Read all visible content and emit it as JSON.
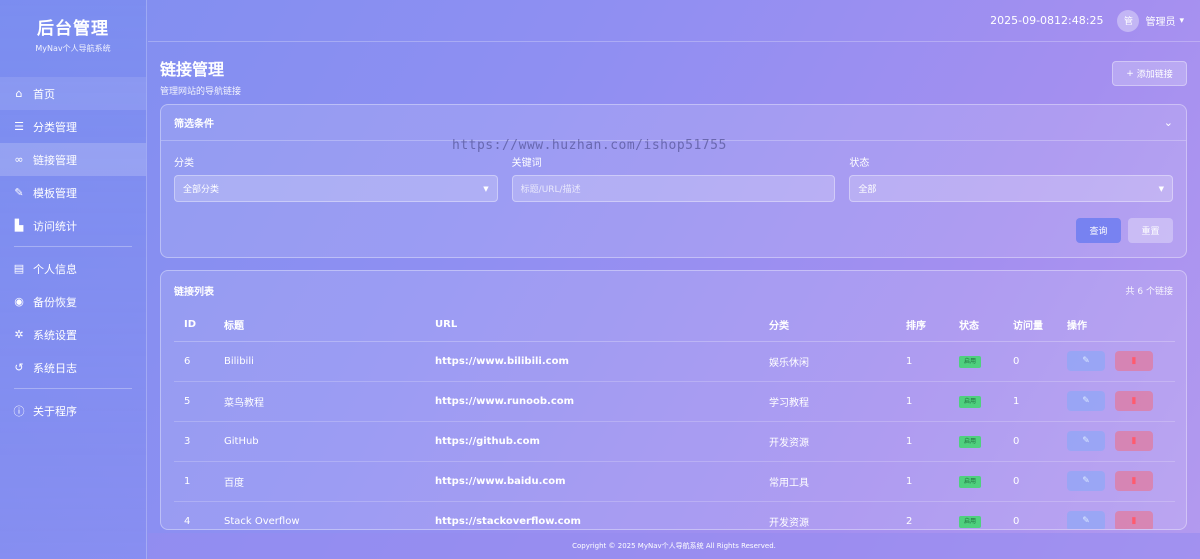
{
  "brand": {
    "title": "后台管理",
    "subtitle": "MyNav个人导航系统"
  },
  "nav": {
    "items": [
      {
        "label": "首页",
        "icon": "home-icon"
      },
      {
        "label": "分类管理",
        "icon": "list-icon"
      },
      {
        "label": "链接管理",
        "icon": "link-icon"
      },
      {
        "label": "模板管理",
        "icon": "brush-icon"
      },
      {
        "label": "访问统计",
        "icon": "chart-icon"
      },
      {
        "label": "个人信息",
        "icon": "id-card-icon"
      },
      {
        "label": "备份恢复",
        "icon": "database-icon"
      },
      {
        "label": "系统设置",
        "icon": "gear-icon"
      },
      {
        "label": "系统日志",
        "icon": "history-icon"
      },
      {
        "label": "关于程序",
        "icon": "info-icon"
      }
    ]
  },
  "topbar": {
    "datetime": "2025-09-0812:48:25",
    "avatar": "管",
    "user": "管理员"
  },
  "page": {
    "title": "链接管理",
    "subtitle": "管理网站的导航链接",
    "add_label": "添加链接"
  },
  "filter": {
    "title": "筛选条件",
    "category_label": "分类",
    "category_value": "全部分类",
    "keyword_label": "关键词",
    "keyword_placeholder": "标题/URL/描述",
    "status_label": "状态",
    "status_value": "全部",
    "query_label": "查询",
    "reset_label": "重置"
  },
  "list": {
    "title": "链接列表",
    "count": "共 6 个链接",
    "columns": [
      "ID",
      "标题",
      "URL",
      "分类",
      "排序",
      "状态",
      "访问量",
      "操作"
    ],
    "rows": [
      {
        "id": "6",
        "title": "Bilibili",
        "url": "https://www.bilibili.com",
        "category": "娱乐休闲",
        "sort": "1",
        "status": "启用",
        "visits": "0"
      },
      {
        "id": "5",
        "title": "菜鸟教程",
        "url": "https://www.runoob.com",
        "category": "学习教程",
        "sort": "1",
        "status": "启用",
        "visits": "1"
      },
      {
        "id": "3",
        "title": "GitHub",
        "url": "https://github.com",
        "category": "开发资源",
        "sort": "1",
        "status": "启用",
        "visits": "0"
      },
      {
        "id": "1",
        "title": "百度",
        "url": "https://www.baidu.com",
        "category": "常用工具",
        "sort": "1",
        "status": "启用",
        "visits": "0"
      },
      {
        "id": "4",
        "title": "Stack Overflow",
        "url": "https://stackoverflow.com",
        "category": "开发资源",
        "sort": "2",
        "status": "启用",
        "visits": "0"
      }
    ]
  },
  "footer": {
    "text": "Copyright © 2025 MyNav个人导航系统 All Rights Reserved."
  },
  "watermark": "https://www.huzhan.com/ishop51755"
}
